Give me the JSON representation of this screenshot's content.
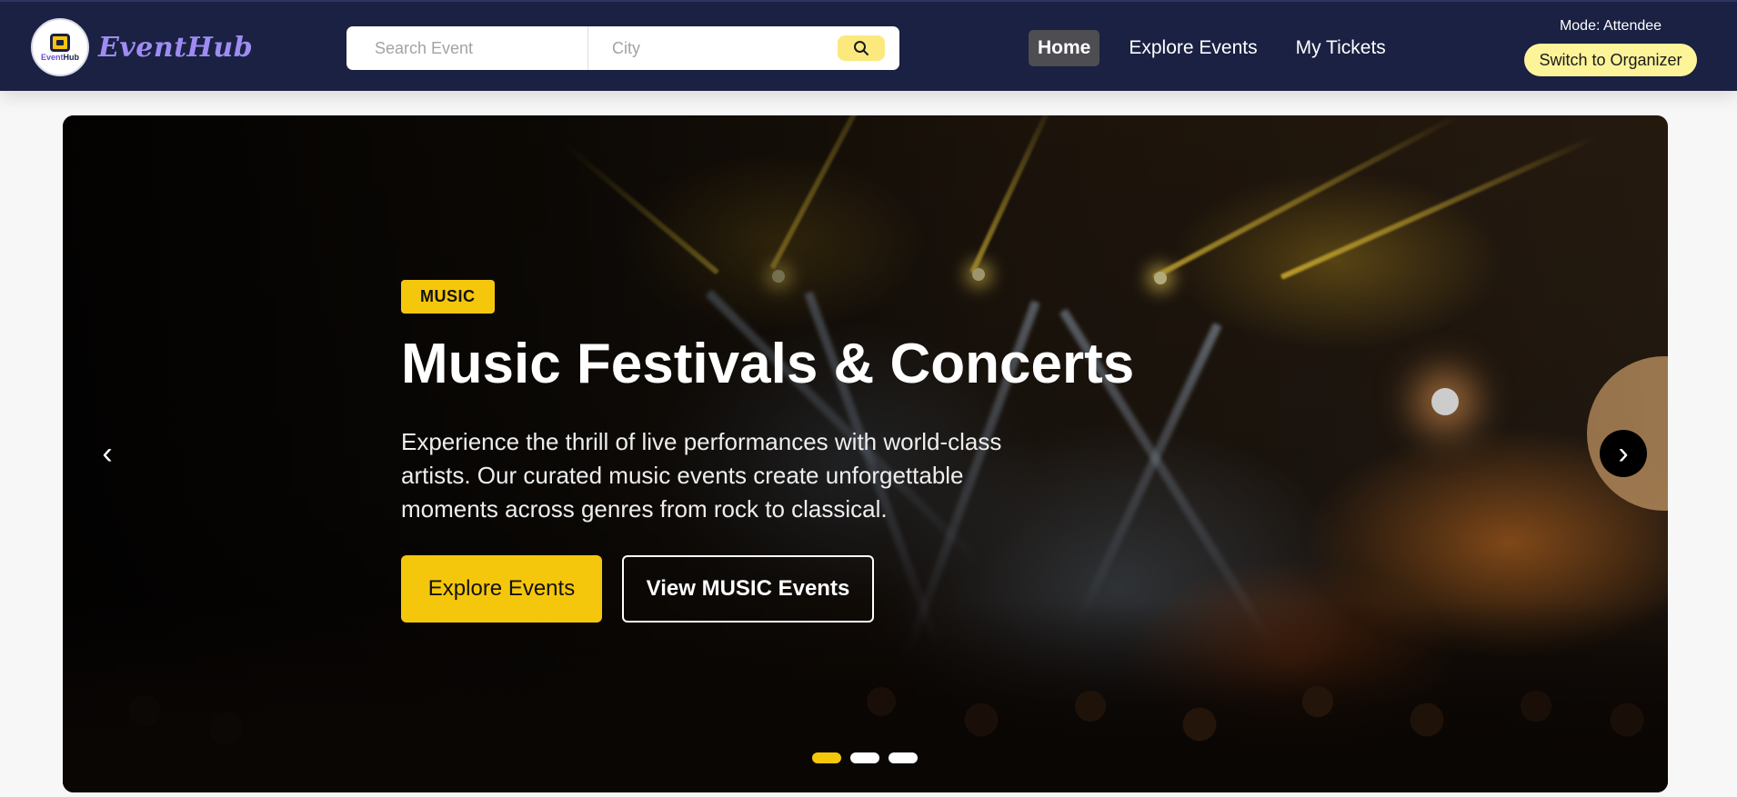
{
  "header": {
    "brand": "EventHub",
    "logo_event": "Event",
    "logo_hub": "Hub",
    "search": {
      "event_placeholder": "Search Event",
      "event_value": "",
      "city_placeholder": "City",
      "city_value": "",
      "button_icon": "search-icon"
    },
    "nav": [
      {
        "label": "Home",
        "active": true
      },
      {
        "label": "Explore Events",
        "active": false
      },
      {
        "label": "My Tickets",
        "active": false
      }
    ],
    "mode_label": "Mode: Attendee",
    "switch_label": "Switch to Organizer"
  },
  "hero": {
    "category": "MUSIC",
    "title": "Music Festivals & Concerts",
    "description": "Experience the thrill of live performances with world-class artists. Our curated music events create unforgettable moments across genres from rock to classical.",
    "primary_button": "Explore Events",
    "secondary_button": "View MUSIC Events",
    "prev_arrow": "‹",
    "next_arrow": "›",
    "slide_count": 3,
    "active_slide": 1
  },
  "colors": {
    "navbar_bg": "#1a2142",
    "brand": "#9f8cf2",
    "accent_yellow": "#f5c70c",
    "switch_bg": "#fdf49a",
    "search_btn_bg": "#fbe97e",
    "active_nav_bg": "#4d4d52"
  }
}
